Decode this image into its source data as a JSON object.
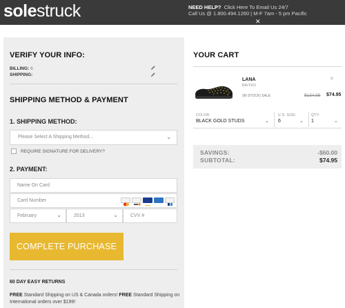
{
  "header": {
    "logo_bold": "sole",
    "logo_light": "struck",
    "help_label": "NEED HELP?",
    "help_link": "Click Here To Email Us 24/7",
    "help_phone": "Call Us @ 1.800.494.1260 | M-F 7am - 5 pm Pacific",
    "close": "✕"
  },
  "verify": {
    "title": "VERIFY YOUR INFO:",
    "billing_label": "BILLING:",
    "billing_value": "6",
    "shipping_label": "SHIPPING:"
  },
  "shipping_payment": {
    "title": "SHIPPING METHOD & PAYMENT",
    "shipping_method_title": "1. SHIPPING METHOD:",
    "shipping_select_placeholder": "Please Select A Shipping Method...",
    "signature_label": "REQUIRE SIGNATURE FOR DELIVERY?",
    "payment_title": "2. PAYMENT:",
    "name_placeholder": "Name On Card",
    "card_placeholder": "Card Number",
    "month_value": "February",
    "year_value": "2013",
    "cvv_placeholder": "CVV #",
    "complete_button": "COMPLETE PURCHASE",
    "returns_title": "60 DAY EASY RETURNS",
    "free_1": "FREE",
    "free_text_1": " Standard Shipping on US & Canada orders! ",
    "free_2": "FREE",
    "free_text_2": " Standard Shipping on International orders over $199!"
  },
  "cart": {
    "title": "YOUR CART",
    "product_name": "LANA",
    "product_brand": "BAITKO",
    "stock_status": "(IN STOCK) SALE",
    "old_price": "$134.95",
    "new_price": "$74.95",
    "remove": "✕",
    "color_label": "COLOR:",
    "color_value": "BLACK GOLD STUDS",
    "size_label": "U.S. SIZE:",
    "size_value": "6",
    "qty_label": "QTY:",
    "qty_value": "1",
    "savings_label": "SAVINGS:",
    "savings_value": "-$60.00",
    "subtotal_label": "SUBTOTAL:",
    "subtotal_value": "$74.95"
  },
  "colors": {
    "topbar": "#3a3a3a",
    "button": "#e8b830",
    "panel": "#eeeeee"
  },
  "icons": {
    "card_brands": [
      "mastercard-icon",
      "discover-icon",
      "visa-icon",
      "amex-icon",
      "paypal-icon"
    ]
  }
}
